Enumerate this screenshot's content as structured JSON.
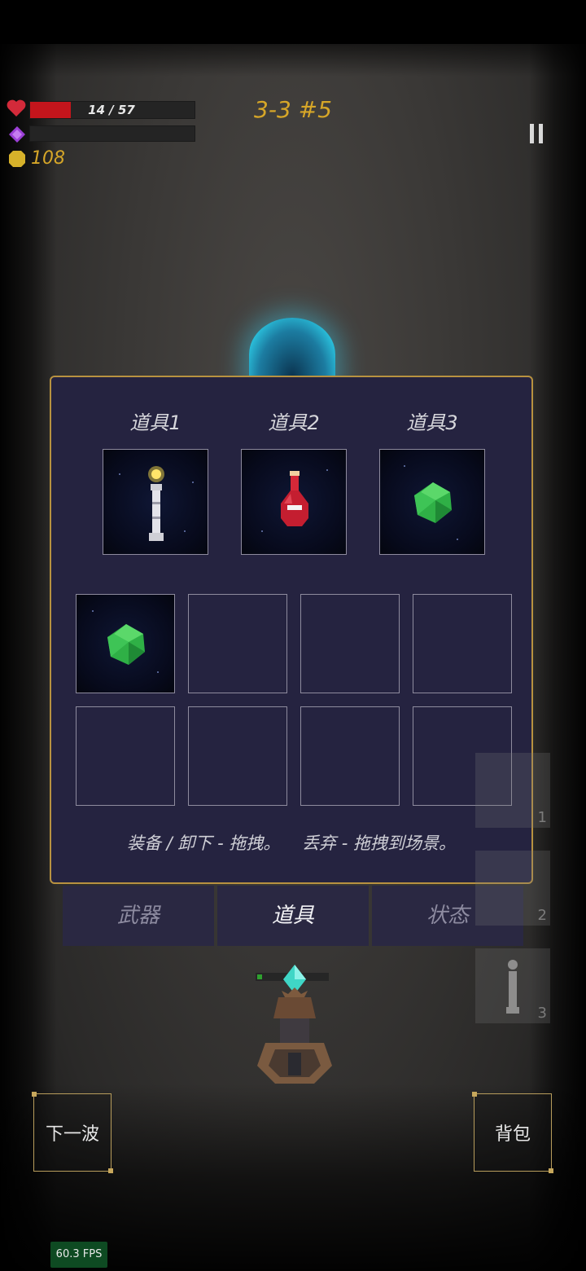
{
  "hud": {
    "hp_text": "14 / 57",
    "hp_current": 14,
    "hp_max": 57,
    "gold": "108",
    "level": "3-3 #5",
    "colors": {
      "hp": "#c4151c",
      "gold": "#d6a628"
    }
  },
  "panel": {
    "equip_slots": [
      {
        "label": "道具1",
        "item": "torch-staff-icon"
      },
      {
        "label": "道具2",
        "item": "red-potion-icon"
      },
      {
        "label": "道具3",
        "item": "green-gem-icon"
      }
    ],
    "inventory": [
      {
        "item": "green-gem-icon"
      },
      {
        "item": ""
      },
      {
        "item": ""
      },
      {
        "item": ""
      },
      {
        "item": ""
      },
      {
        "item": ""
      },
      {
        "item": ""
      },
      {
        "item": ""
      }
    ],
    "hint": "装备 / 卸下 - 拖拽。    丢弃 - 拖拽到场景。",
    "border_color": "#b89240"
  },
  "tabs": [
    {
      "label": "武器",
      "active": false
    },
    {
      "label": "道具",
      "active": true
    },
    {
      "label": "状态",
      "active": false
    }
  ],
  "quickslots": [
    {
      "num": "1",
      "item": ""
    },
    {
      "num": "2",
      "item": ""
    },
    {
      "num": "3",
      "item": "torch-staff-icon"
    }
  ],
  "buttons": {
    "next_wave": "下一波",
    "backpack": "背包"
  },
  "fps": "60.3 FPS"
}
